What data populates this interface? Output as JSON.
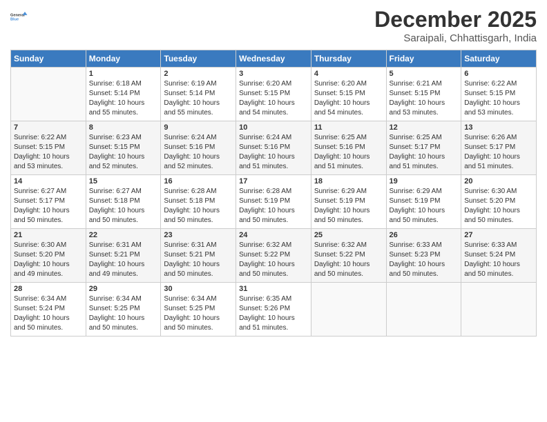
{
  "header": {
    "logo_line1": "General",
    "logo_line2": "Blue",
    "month": "December 2025",
    "location": "Saraipali, Chhattisgarh, India"
  },
  "weekdays": [
    "Sunday",
    "Monday",
    "Tuesday",
    "Wednesday",
    "Thursday",
    "Friday",
    "Saturday"
  ],
  "weeks": [
    [
      {
        "day": "",
        "sunrise": "",
        "sunset": "",
        "daylight": ""
      },
      {
        "day": "1",
        "sunrise": "Sunrise: 6:18 AM",
        "sunset": "Sunset: 5:14 PM",
        "daylight": "Daylight: 10 hours and 55 minutes."
      },
      {
        "day": "2",
        "sunrise": "Sunrise: 6:19 AM",
        "sunset": "Sunset: 5:14 PM",
        "daylight": "Daylight: 10 hours and 55 minutes."
      },
      {
        "day": "3",
        "sunrise": "Sunrise: 6:20 AM",
        "sunset": "Sunset: 5:15 PM",
        "daylight": "Daylight: 10 hours and 54 minutes."
      },
      {
        "day": "4",
        "sunrise": "Sunrise: 6:20 AM",
        "sunset": "Sunset: 5:15 PM",
        "daylight": "Daylight: 10 hours and 54 minutes."
      },
      {
        "day": "5",
        "sunrise": "Sunrise: 6:21 AM",
        "sunset": "Sunset: 5:15 PM",
        "daylight": "Daylight: 10 hours and 53 minutes."
      },
      {
        "day": "6",
        "sunrise": "Sunrise: 6:22 AM",
        "sunset": "Sunset: 5:15 PM",
        "daylight": "Daylight: 10 hours and 53 minutes."
      }
    ],
    [
      {
        "day": "7",
        "sunrise": "Sunrise: 6:22 AM",
        "sunset": "Sunset: 5:15 PM",
        "daylight": "Daylight: 10 hours and 53 minutes."
      },
      {
        "day": "8",
        "sunrise": "Sunrise: 6:23 AM",
        "sunset": "Sunset: 5:15 PM",
        "daylight": "Daylight: 10 hours and 52 minutes."
      },
      {
        "day": "9",
        "sunrise": "Sunrise: 6:24 AM",
        "sunset": "Sunset: 5:16 PM",
        "daylight": "Daylight: 10 hours and 52 minutes."
      },
      {
        "day": "10",
        "sunrise": "Sunrise: 6:24 AM",
        "sunset": "Sunset: 5:16 PM",
        "daylight": "Daylight: 10 hours and 51 minutes."
      },
      {
        "day": "11",
        "sunrise": "Sunrise: 6:25 AM",
        "sunset": "Sunset: 5:16 PM",
        "daylight": "Daylight: 10 hours and 51 minutes."
      },
      {
        "day": "12",
        "sunrise": "Sunrise: 6:25 AM",
        "sunset": "Sunset: 5:17 PM",
        "daylight": "Daylight: 10 hours and 51 minutes."
      },
      {
        "day": "13",
        "sunrise": "Sunrise: 6:26 AM",
        "sunset": "Sunset: 5:17 PM",
        "daylight": "Daylight: 10 hours and 51 minutes."
      }
    ],
    [
      {
        "day": "14",
        "sunrise": "Sunrise: 6:27 AM",
        "sunset": "Sunset: 5:17 PM",
        "daylight": "Daylight: 10 hours and 50 minutes."
      },
      {
        "day": "15",
        "sunrise": "Sunrise: 6:27 AM",
        "sunset": "Sunset: 5:18 PM",
        "daylight": "Daylight: 10 hours and 50 minutes."
      },
      {
        "day": "16",
        "sunrise": "Sunrise: 6:28 AM",
        "sunset": "Sunset: 5:18 PM",
        "daylight": "Daylight: 10 hours and 50 minutes."
      },
      {
        "day": "17",
        "sunrise": "Sunrise: 6:28 AM",
        "sunset": "Sunset: 5:19 PM",
        "daylight": "Daylight: 10 hours and 50 minutes."
      },
      {
        "day": "18",
        "sunrise": "Sunrise: 6:29 AM",
        "sunset": "Sunset: 5:19 PM",
        "daylight": "Daylight: 10 hours and 50 minutes."
      },
      {
        "day": "19",
        "sunrise": "Sunrise: 6:29 AM",
        "sunset": "Sunset: 5:19 PM",
        "daylight": "Daylight: 10 hours and 50 minutes."
      },
      {
        "day": "20",
        "sunrise": "Sunrise: 6:30 AM",
        "sunset": "Sunset: 5:20 PM",
        "daylight": "Daylight: 10 hours and 50 minutes."
      }
    ],
    [
      {
        "day": "21",
        "sunrise": "Sunrise: 6:30 AM",
        "sunset": "Sunset: 5:20 PM",
        "daylight": "Daylight: 10 hours and 49 minutes."
      },
      {
        "day": "22",
        "sunrise": "Sunrise: 6:31 AM",
        "sunset": "Sunset: 5:21 PM",
        "daylight": "Daylight: 10 hours and 49 minutes."
      },
      {
        "day": "23",
        "sunrise": "Sunrise: 6:31 AM",
        "sunset": "Sunset: 5:21 PM",
        "daylight": "Daylight: 10 hours and 50 minutes."
      },
      {
        "day": "24",
        "sunrise": "Sunrise: 6:32 AM",
        "sunset": "Sunset: 5:22 PM",
        "daylight": "Daylight: 10 hours and 50 minutes."
      },
      {
        "day": "25",
        "sunrise": "Sunrise: 6:32 AM",
        "sunset": "Sunset: 5:22 PM",
        "daylight": "Daylight: 10 hours and 50 minutes."
      },
      {
        "day": "26",
        "sunrise": "Sunrise: 6:33 AM",
        "sunset": "Sunset: 5:23 PM",
        "daylight": "Daylight: 10 hours and 50 minutes."
      },
      {
        "day": "27",
        "sunrise": "Sunrise: 6:33 AM",
        "sunset": "Sunset: 5:24 PM",
        "daylight": "Daylight: 10 hours and 50 minutes."
      }
    ],
    [
      {
        "day": "28",
        "sunrise": "Sunrise: 6:34 AM",
        "sunset": "Sunset: 5:24 PM",
        "daylight": "Daylight: 10 hours and 50 minutes."
      },
      {
        "day": "29",
        "sunrise": "Sunrise: 6:34 AM",
        "sunset": "Sunset: 5:25 PM",
        "daylight": "Daylight: 10 hours and 50 minutes."
      },
      {
        "day": "30",
        "sunrise": "Sunrise: 6:34 AM",
        "sunset": "Sunset: 5:25 PM",
        "daylight": "Daylight: 10 hours and 50 minutes."
      },
      {
        "day": "31",
        "sunrise": "Sunrise: 6:35 AM",
        "sunset": "Sunset: 5:26 PM",
        "daylight": "Daylight: 10 hours and 51 minutes."
      },
      {
        "day": "",
        "sunrise": "",
        "sunset": "",
        "daylight": ""
      },
      {
        "day": "",
        "sunrise": "",
        "sunset": "",
        "daylight": ""
      },
      {
        "day": "",
        "sunrise": "",
        "sunset": "",
        "daylight": ""
      }
    ]
  ]
}
